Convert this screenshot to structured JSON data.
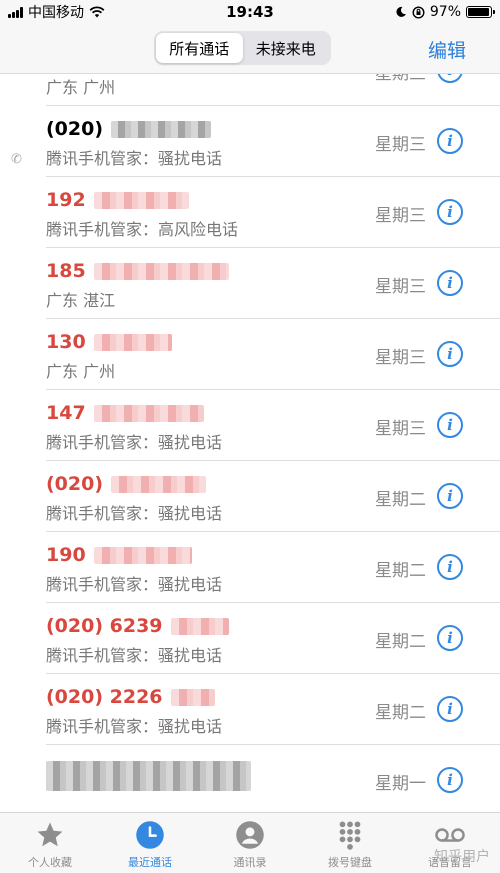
{
  "status_bar": {
    "carrier": "中国移动",
    "time": "19:43",
    "battery_text": "97%",
    "battery_level": 0.97
  },
  "nav": {
    "segments": [
      "所有通话",
      "未接来电"
    ],
    "selected_segment": "所有通话",
    "edit_label": "编辑"
  },
  "calls": [
    {
      "number": "",
      "label": "广东 广州",
      "day": "星期三",
      "missed": false,
      "redacted": false
    },
    {
      "number": "(020)",
      "label": "腾讯手机管家：骚扰电话",
      "day": "星期三",
      "missed": false,
      "outgoing": true
    },
    {
      "number": "192",
      "label": "腾讯手机管家：高风险电话",
      "day": "星期三",
      "missed": true
    },
    {
      "number": "185",
      "label": "广东 湛江",
      "day": "星期三",
      "missed": true
    },
    {
      "number": "130",
      "label": "广东 广州",
      "day": "星期三",
      "missed": true
    },
    {
      "number": "147",
      "label": "腾讯手机管家：骚扰电话",
      "day": "星期三",
      "missed": true
    },
    {
      "number": "(020)",
      "label": "腾讯手机管家：骚扰电话",
      "day": "星期二",
      "missed": true
    },
    {
      "number": "190",
      "label": "腾讯手机管家：骚扰电话",
      "day": "星期二",
      "missed": true
    },
    {
      "number": "(020) 6239",
      "label": "腾讯手机管家：骚扰电话",
      "day": "星期二",
      "missed": true
    },
    {
      "number": "(020) 2226",
      "label": "腾讯手机管家：骚扰电话",
      "day": "星期二",
      "missed": true
    },
    {
      "number": "",
      "label": "",
      "day": "星期一",
      "missed": false
    }
  ],
  "tabs": [
    {
      "label": "个人收藏",
      "icon": "star-icon"
    },
    {
      "label": "最近通话",
      "icon": "clock-icon"
    },
    {
      "label": "通讯录",
      "icon": "person-icon"
    },
    {
      "label": "拨号键盘",
      "icon": "keypad-icon"
    },
    {
      "label": "语音留言",
      "icon": "voicemail-icon"
    }
  ],
  "active_tab": "最近通话",
  "watermark": "知乎用户",
  "colors": {
    "accent": "#3488e0",
    "missed": "#d8483e"
  }
}
